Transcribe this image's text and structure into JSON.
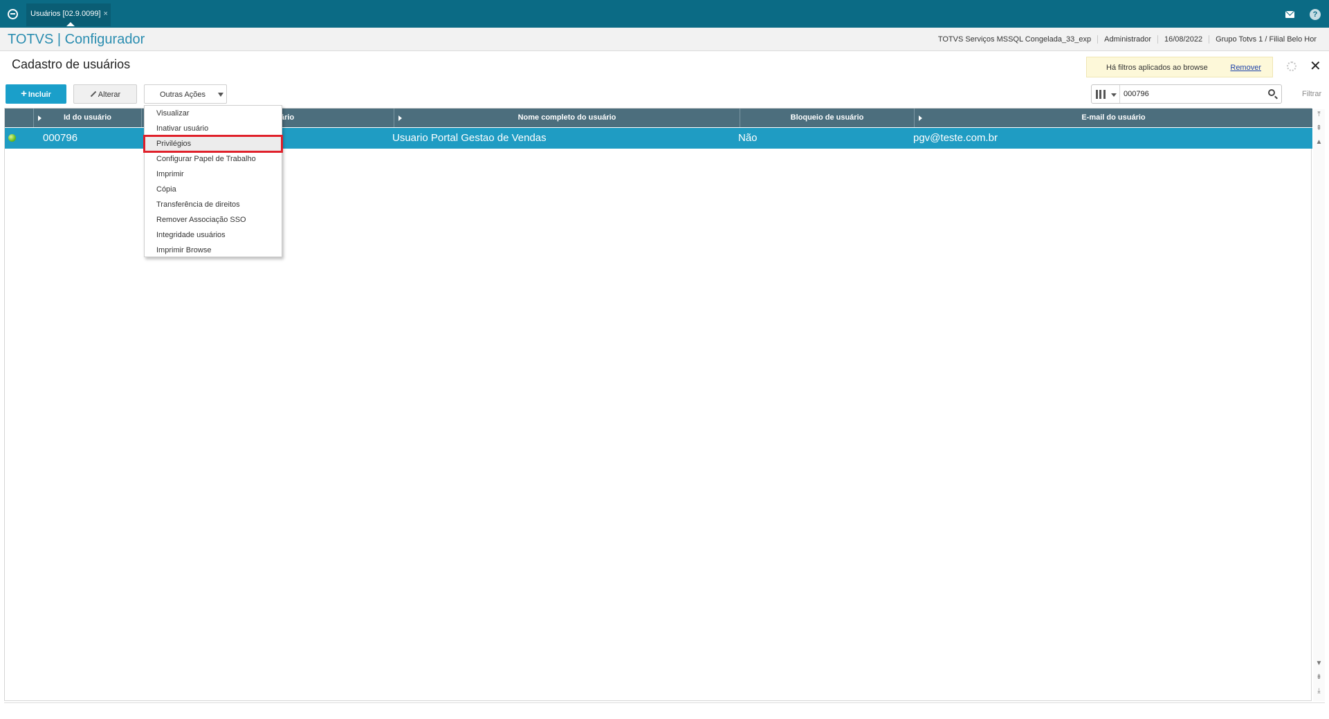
{
  "window": {
    "tab_title": "Usuários [02.9.0099]",
    "tab_close": "×"
  },
  "app": {
    "title": "TOTVS | Configurador",
    "environment": "TOTVS Serviços MSSQL Congelada_33_exp",
    "user": "Administrador",
    "date": "16/08/2022",
    "company": "Grupo Totvs 1 / Filial Belo Hor"
  },
  "page": {
    "title": "Cadastro de usuários",
    "filter_notice": "Há filtros aplicados ao browse",
    "filter_remove": "Remover",
    "close_symbol": "✕"
  },
  "toolbar": {
    "incluir": "Incluir",
    "alterar": "Alterar",
    "outras_acoes": "Outras Ações",
    "search_value": "000796",
    "filtrar": "Filtrar"
  },
  "grid": {
    "columns": [
      "Id do usuário",
      "ário",
      "Nome completo do usuário",
      "Bloqueio de usuário",
      "E-mail do usuário"
    ],
    "rows": [
      {
        "id": "000796",
        "nome": "Usuario Portal Gestao de Vendas",
        "bloqueio": "Não",
        "email": "pgv@teste.com.br",
        "status_color": "#6fbf1c"
      }
    ]
  },
  "menu": {
    "items": [
      "Visualizar",
      "Inativar usuário",
      "Privilégios",
      "Configurar Papel de Trabalho",
      "Imprimir",
      "Cópia",
      "Transferência de direitos",
      "Remover Associação SSO",
      "Integridade usuários",
      "Imprimir Browse"
    ],
    "highlighted_index": 2
  },
  "colors": {
    "topbar": "#0b6b85",
    "accent": "#1a9fca",
    "grid_header": "#4c6e7d",
    "selected_row": "#1f9cc3",
    "highlight_outline": "#e0202a"
  }
}
